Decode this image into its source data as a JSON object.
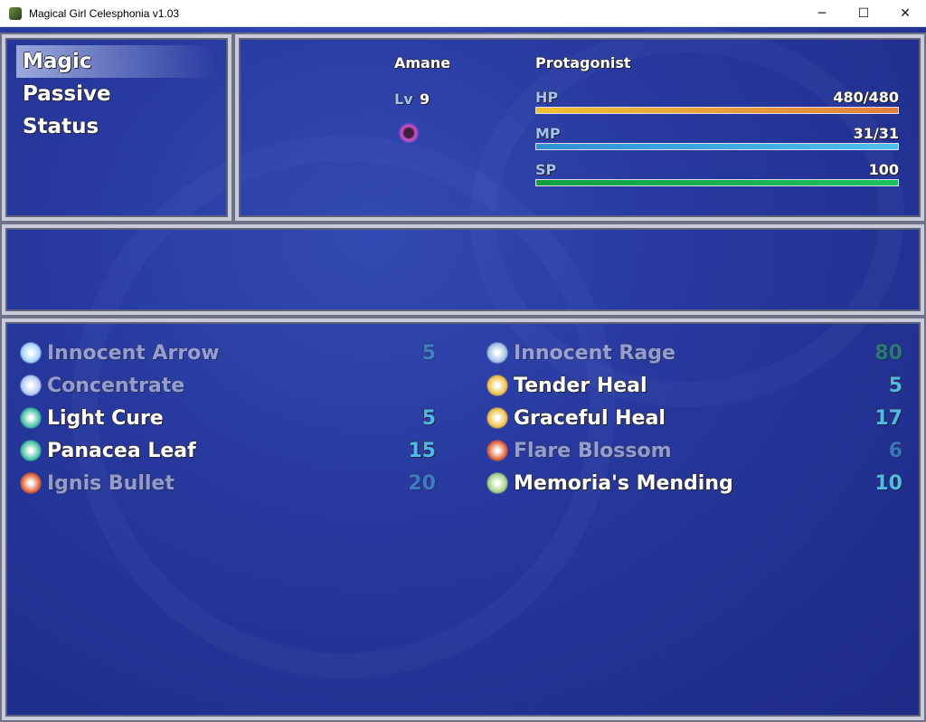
{
  "window": {
    "title": "Magical Girl Celesphonia v1.03",
    "controls": [
      "─",
      "☐",
      "✕"
    ]
  },
  "menu": {
    "commands": [
      {
        "label": "Magic",
        "selected": true
      },
      {
        "label": "Passive",
        "selected": false
      },
      {
        "label": "Status",
        "selected": false
      }
    ]
  },
  "actor": {
    "name": "Amane",
    "class": "Protagonist",
    "level_label": "Lv",
    "level": "9",
    "state_icon": "dark-vortex-icon",
    "hp": {
      "label": "HP",
      "value": "480/480",
      "fraction": 1.0,
      "colors": [
        "#f0c030",
        "#e08040"
      ]
    },
    "mp": {
      "label": "MP",
      "value": "31/31",
      "fraction": 1.0,
      "colors": [
        "#3090d0",
        "#50c0f0"
      ]
    },
    "sp": {
      "label": "SP",
      "value": "100",
      "fraction": 1.0,
      "colors": [
        "#10a040",
        "#20c060"
      ]
    }
  },
  "help": {
    "text": ""
  },
  "skills": [
    {
      "name": "Innocent Arrow",
      "cost": "5",
      "enabled": false,
      "icon": "star-burst-icon",
      "icon_color": "#a0d0ff",
      "cost_color": "#50b8f0"
    },
    {
      "name": "Innocent Rage",
      "cost": "80",
      "enabled": false,
      "icon": "swirl-icon",
      "icon_color": "#a0c0e0",
      "cost_color": "#30c060"
    },
    {
      "name": "Concentrate",
      "cost": "",
      "enabled": false,
      "icon": "pillar-icon",
      "icon_color": "#b0c8f0",
      "cost_color": "#50b8f0"
    },
    {
      "name": "Tender Heal",
      "cost": "5",
      "enabled": true,
      "icon": "holy-light-icon",
      "icon_color": "#f0c040",
      "cost_color": "#50b8f0"
    },
    {
      "name": "Light Cure",
      "cost": "5",
      "enabled": true,
      "icon": "orb-icon",
      "icon_color": "#40c0a0",
      "cost_color": "#50b8f0"
    },
    {
      "name": "Graceful Heal",
      "cost": "17",
      "enabled": true,
      "icon": "holy-light-icon",
      "icon_color": "#f0c040",
      "cost_color": "#50b8f0"
    },
    {
      "name": "Panacea Leaf",
      "cost": "15",
      "enabled": true,
      "icon": "orb-icon",
      "icon_color": "#40c0a0",
      "cost_color": "#50b8f0"
    },
    {
      "name": "Flare Blossom",
      "cost": "6",
      "enabled": false,
      "icon": "flame-icon",
      "icon_color": "#e06030",
      "cost_color": "#50b8f0"
    },
    {
      "name": "Ignis Bullet",
      "cost": "20",
      "enabled": false,
      "icon": "flame-icon",
      "icon_color": "#e06030",
      "cost_color": "#50b8f0"
    },
    {
      "name": "Memoria's Mending",
      "cost": "10",
      "enabled": true,
      "icon": "leaf-icon",
      "icon_color": "#a0d080",
      "cost_color": "#50b8f0"
    }
  ]
}
